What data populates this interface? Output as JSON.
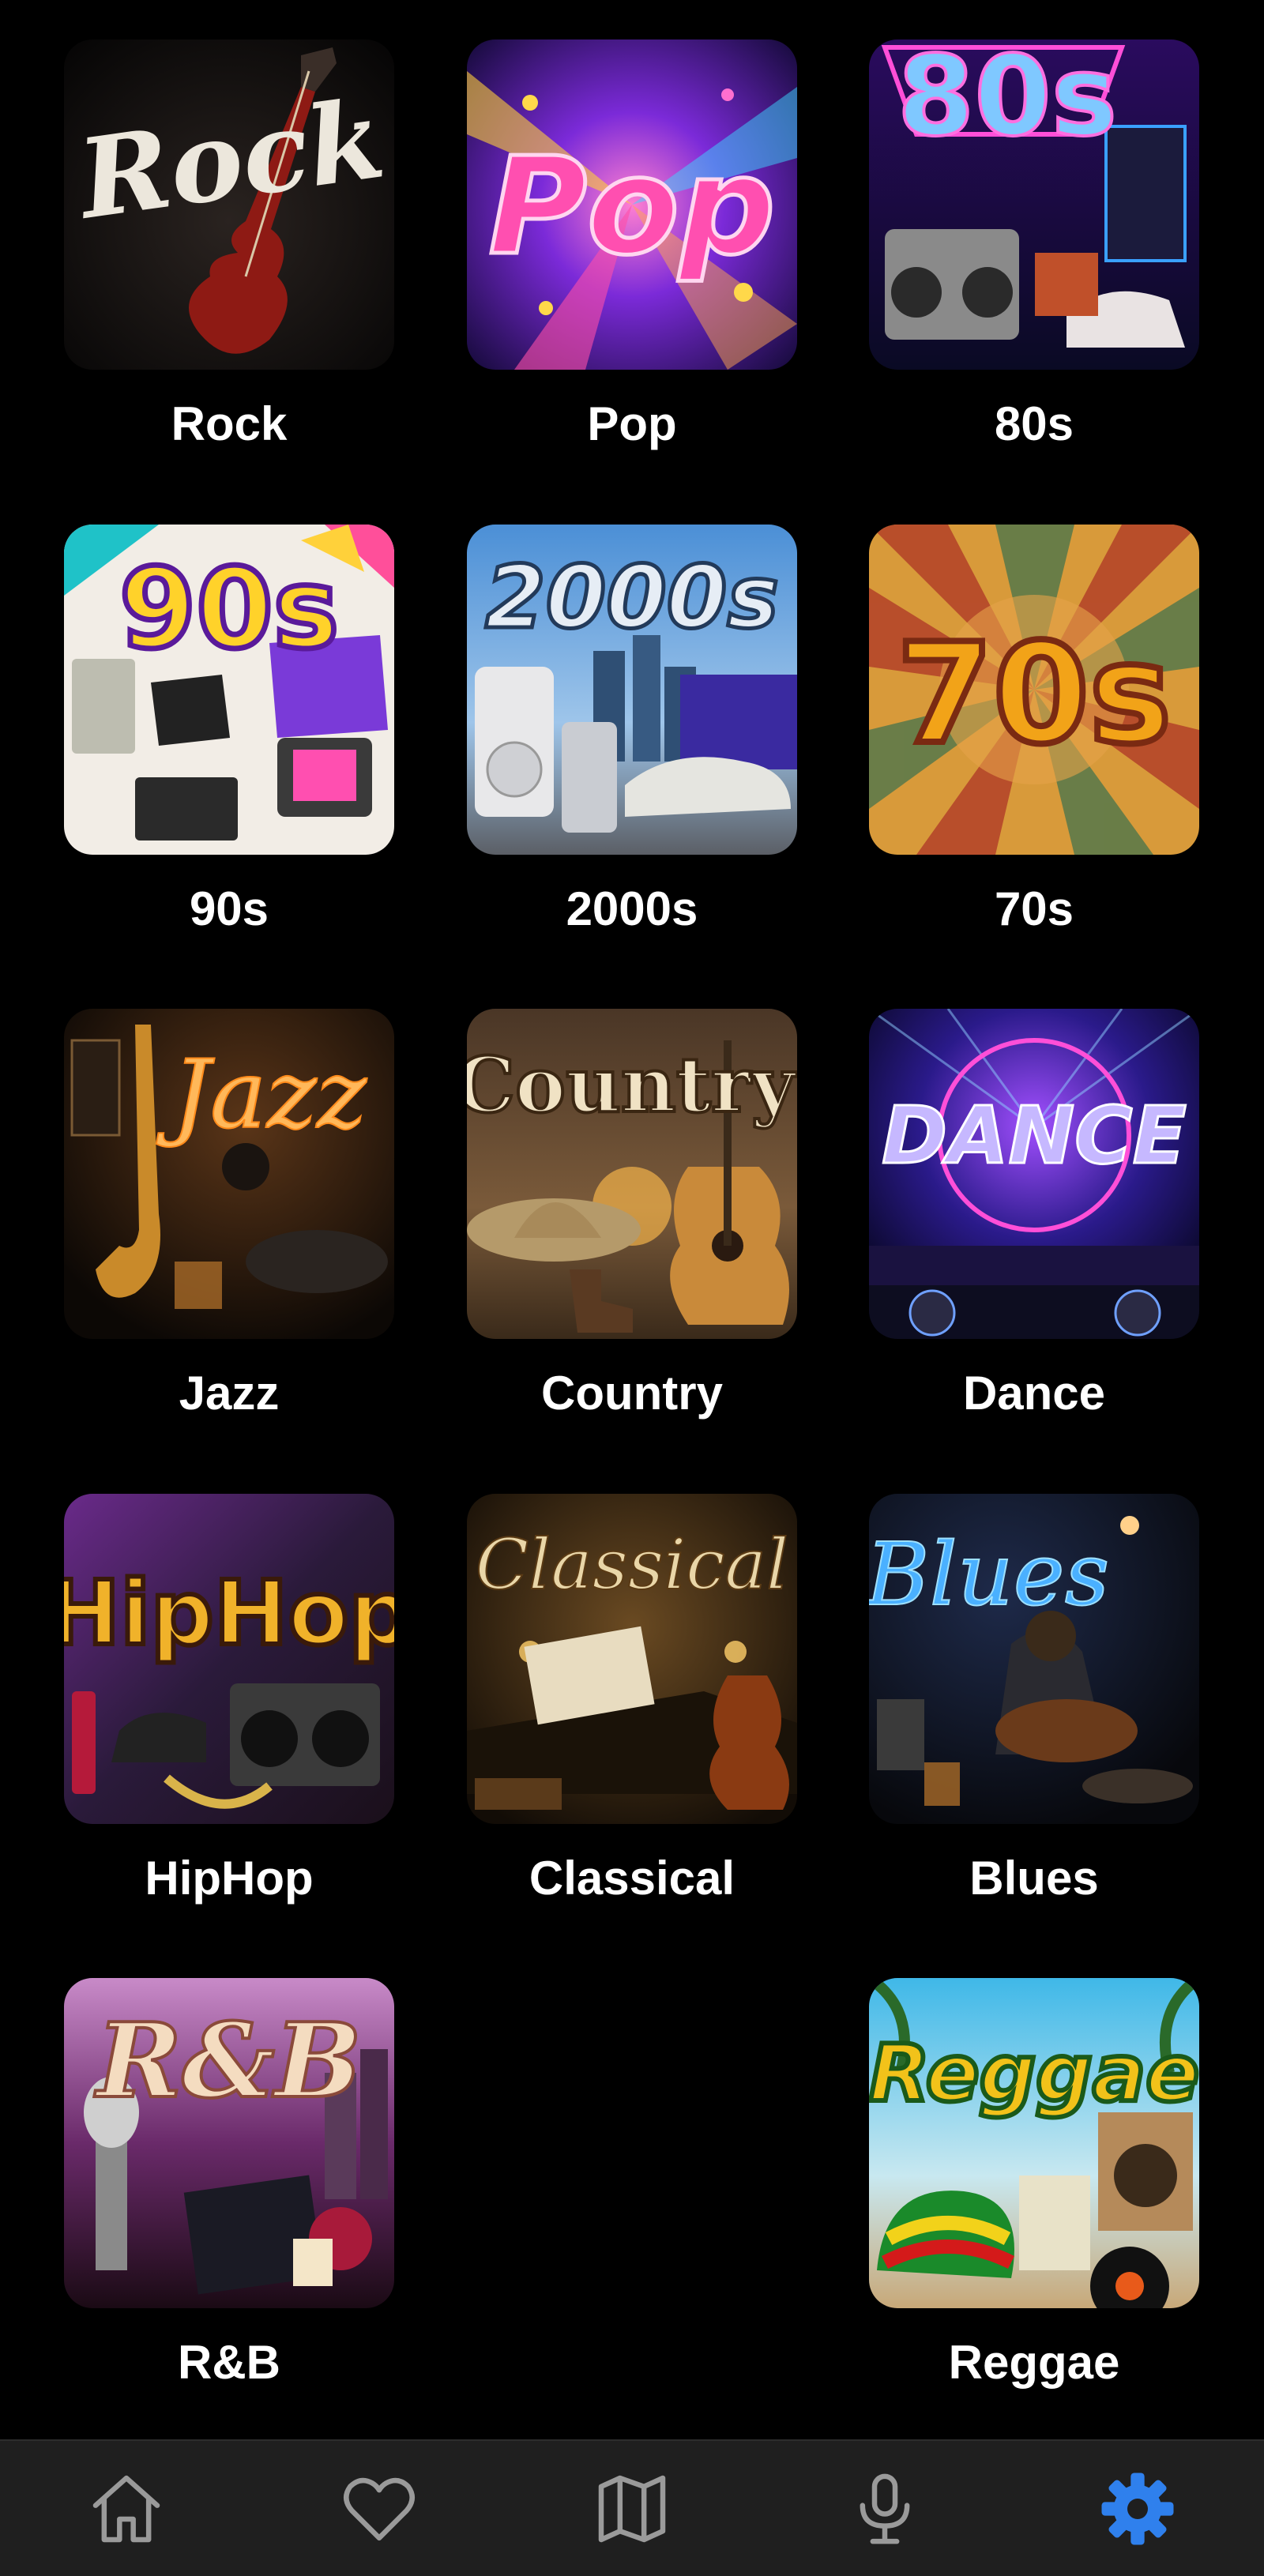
{
  "genres": [
    {
      "label": "Rock",
      "cover_text": "Rock"
    },
    {
      "label": "Pop",
      "cover_text": "Pop"
    },
    {
      "label": "80s",
      "cover_text": "80s"
    },
    {
      "label": "90s",
      "cover_text": "90s"
    },
    {
      "label": "2000s",
      "cover_text": "2000s"
    },
    {
      "label": "70s",
      "cover_text": "70s"
    },
    {
      "label": "Jazz",
      "cover_text": "Jazz"
    },
    {
      "label": "Country",
      "cover_text": "Country"
    },
    {
      "label": "Dance",
      "cover_text": "DANCE"
    },
    {
      "label": "HipHop",
      "cover_text": "HipHop"
    },
    {
      "label": "Classical",
      "cover_text": "Classical"
    },
    {
      "label": "Blues",
      "cover_text": "Blues"
    },
    {
      "label": "R&B",
      "cover_text": "R&B"
    },
    {
      "label": "Reggae",
      "cover_text": "Reggae"
    }
  ],
  "nav": {
    "items": [
      {
        "icon": "home-icon",
        "active": false
      },
      {
        "icon": "heart-icon",
        "active": false
      },
      {
        "icon": "map-icon",
        "active": false
      },
      {
        "icon": "microphone-icon",
        "active": false
      },
      {
        "icon": "gear-icon",
        "active": true
      }
    ],
    "active_color": "#2f80ed",
    "inactive_color": "#9a9a9a"
  }
}
